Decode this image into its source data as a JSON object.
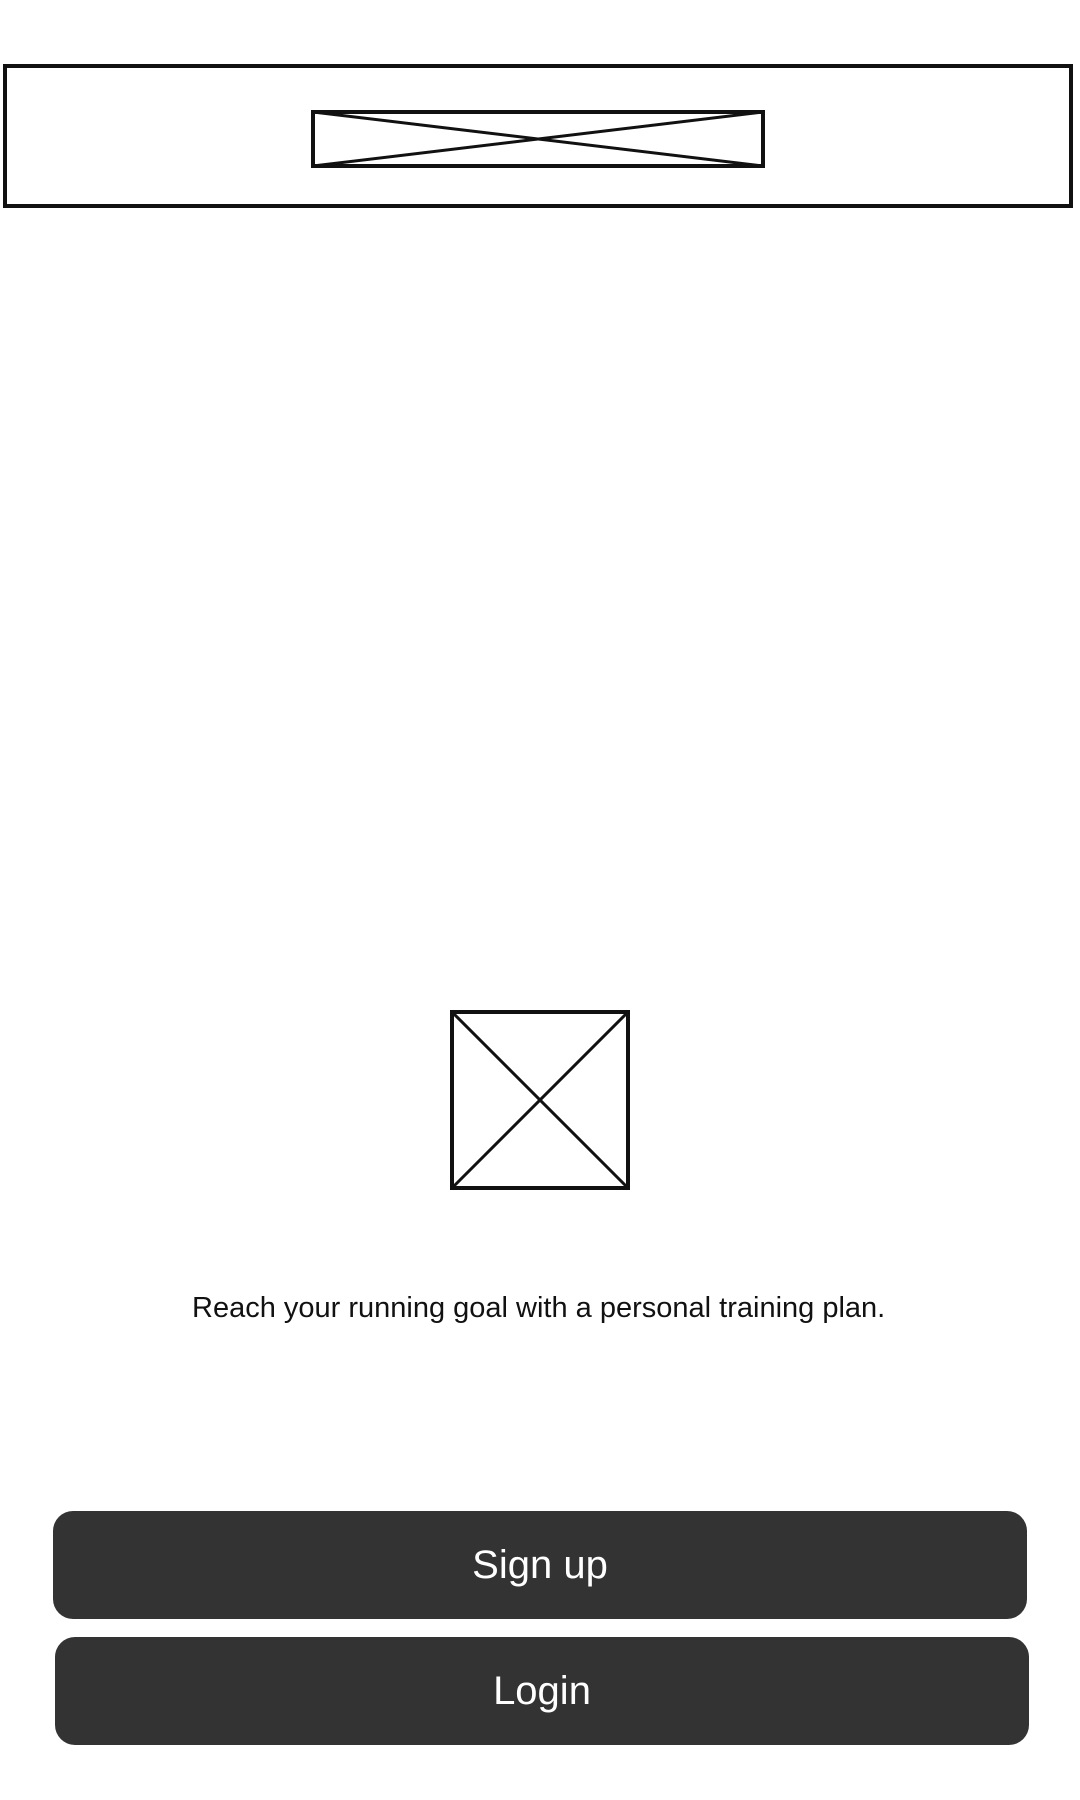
{
  "header": {
    "logo_icon": "image-placeholder-icon"
  },
  "hero": {
    "image_icon": "image-placeholder-icon"
  },
  "tagline": {
    "text": "Reach your running goal with a personal training plan."
  },
  "actions": {
    "signup_label": "Sign up",
    "login_label": "Login"
  },
  "colors": {
    "button_background": "#333333",
    "button_text": "#ffffff",
    "outline": "#111111",
    "background": "#ffffff"
  }
}
